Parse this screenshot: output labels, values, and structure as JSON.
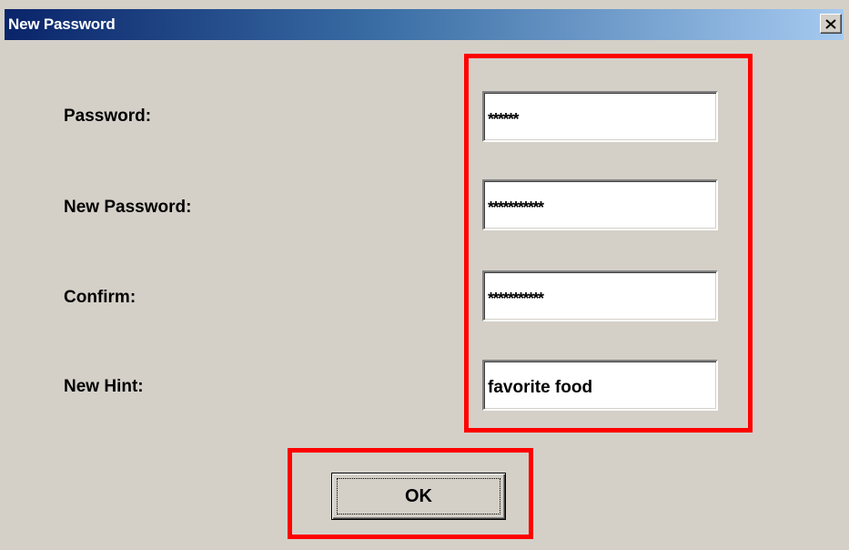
{
  "window": {
    "title": "New Password",
    "close_symbol": "close-icon"
  },
  "form": {
    "password_label": "Password:",
    "password_value": "******",
    "new_password_label": "New Password:",
    "new_password_value": "***********",
    "confirm_label": "Confirm:",
    "confirm_value": "***********",
    "hint_label": "New Hint:",
    "hint_value": "favorite food"
  },
  "buttons": {
    "ok_label": "OK"
  },
  "colors": {
    "dialog_bg": "#d4d0c8",
    "titlebar_start": "#0a246a",
    "titlebar_end": "#a6caf0",
    "highlight": "#ff0000"
  }
}
